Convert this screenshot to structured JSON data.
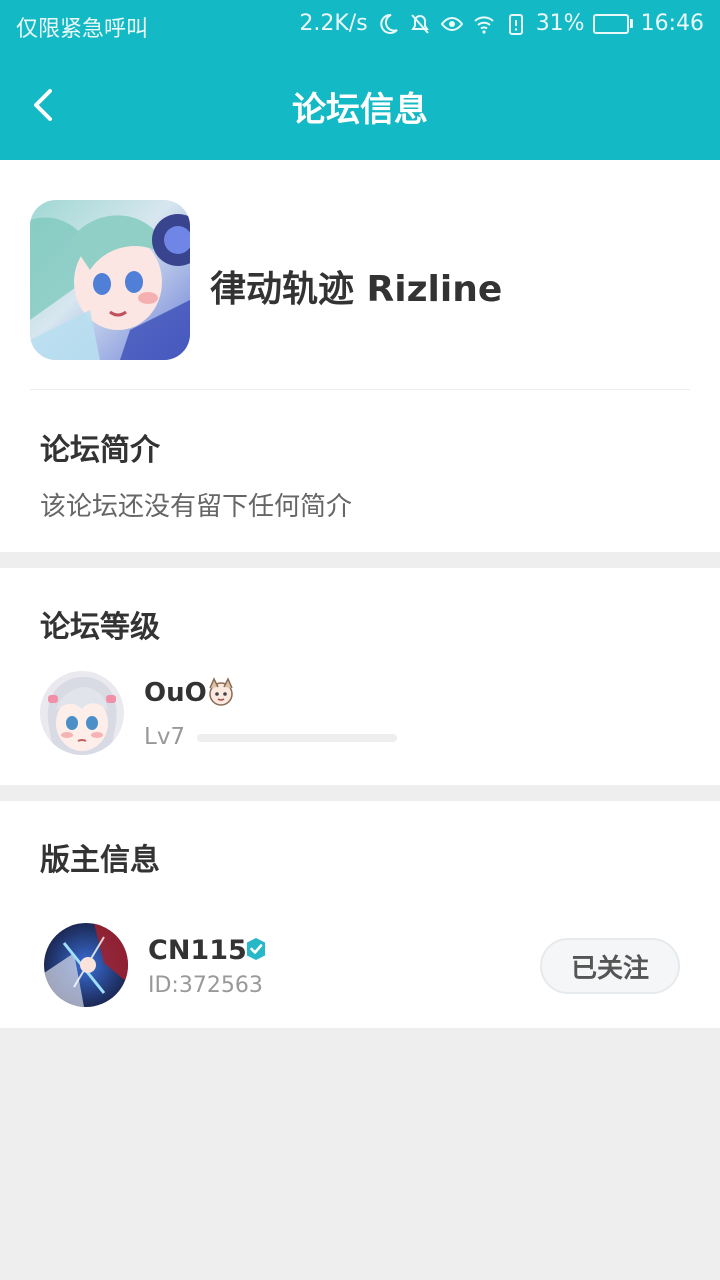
{
  "status_bar": {
    "carrier": "仅限紧急呼叫",
    "speed": "2.2K/s",
    "battery": "31%",
    "battery_level": 0.31,
    "time": "16:46"
  },
  "header": {
    "title": "论坛信息"
  },
  "forum": {
    "name": "律动轨迹 Rizline",
    "intro_title": "论坛简介",
    "intro_text": "该论坛还没有留下任何简介"
  },
  "level": {
    "section_title": "论坛等级",
    "user_name": "OuO",
    "level_label": "Lv7",
    "progress": 0.0
  },
  "moderator": {
    "section_title": "版主信息",
    "name": "CN115",
    "id": "ID:372563",
    "follow_label": "已关注"
  },
  "colors": {
    "accent": "#14b9c6",
    "verified": "#26b8c8"
  }
}
